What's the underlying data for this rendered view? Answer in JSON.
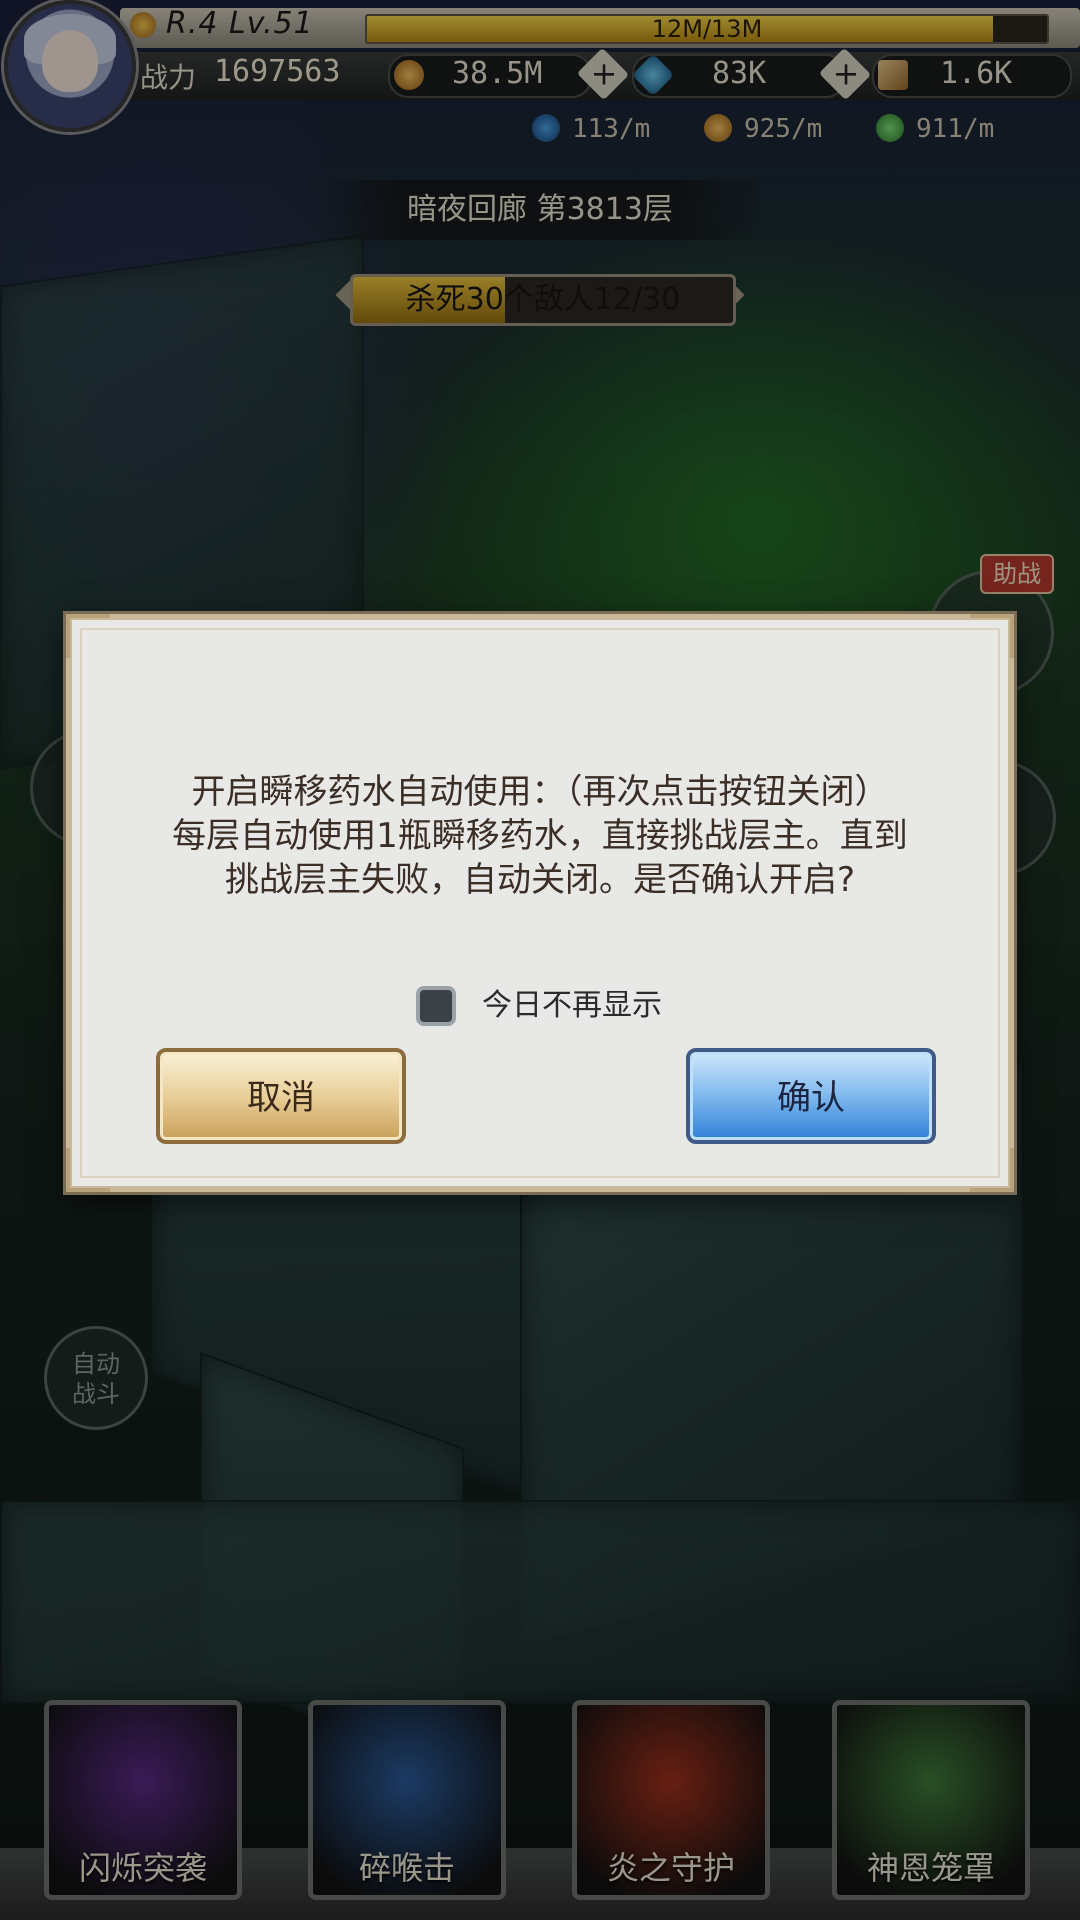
{
  "hud": {
    "rank_level": "R.4 Lv.51",
    "xp_text": "12M/13M",
    "xp_progress": 0.92,
    "power_label": "战力",
    "power_value": "1697563",
    "currencies": [
      {
        "icon": "gold-coin-icon",
        "value": "38.5M"
      },
      {
        "icon": "blue-gem-icon",
        "value": "83K"
      },
      {
        "icon": "scroll-ticket-icon",
        "value": "1.6K"
      }
    ],
    "rates": [
      {
        "icon": "potion-icon",
        "value": "113/m"
      },
      {
        "icon": "gold-coin-icon",
        "value": "925/m"
      },
      {
        "icon": "exp-heart-icon",
        "value": "911/m"
      }
    ]
  },
  "stage": {
    "floor_title": "暗夜回廊  第3813层",
    "quest_text": "杀死30个敌人12/30",
    "quest_progress": 0.4
  },
  "side": {
    "assist_badge": "助战",
    "auto_battle": "自动\n战斗"
  },
  "dialog": {
    "line1": "开启瞬移药水自动使用：（再次点击按钮关闭）",
    "line2": "每层自动使用1瓶瞬移药水，直接挑战层主。直到",
    "line3": "挑战层主失败，自动关闭。是否确认开启?",
    "checkbox_label": "今日不再显示",
    "cancel_label": "取消",
    "confirm_label": "确认"
  },
  "skills": [
    {
      "label": "闪烁突袭",
      "color": "#5a2a86"
    },
    {
      "label": "碎喉击",
      "color": "#2a5a9a"
    },
    {
      "label": "炎之守护",
      "color": "#a0301c"
    },
    {
      "label": "神恩笼罩",
      "color": "#3f7a3a"
    }
  ],
  "colors": {
    "accent_gold": "#e9c33d",
    "confirm_blue": "#2f7fd6",
    "assist_red": "#b53a2e"
  }
}
